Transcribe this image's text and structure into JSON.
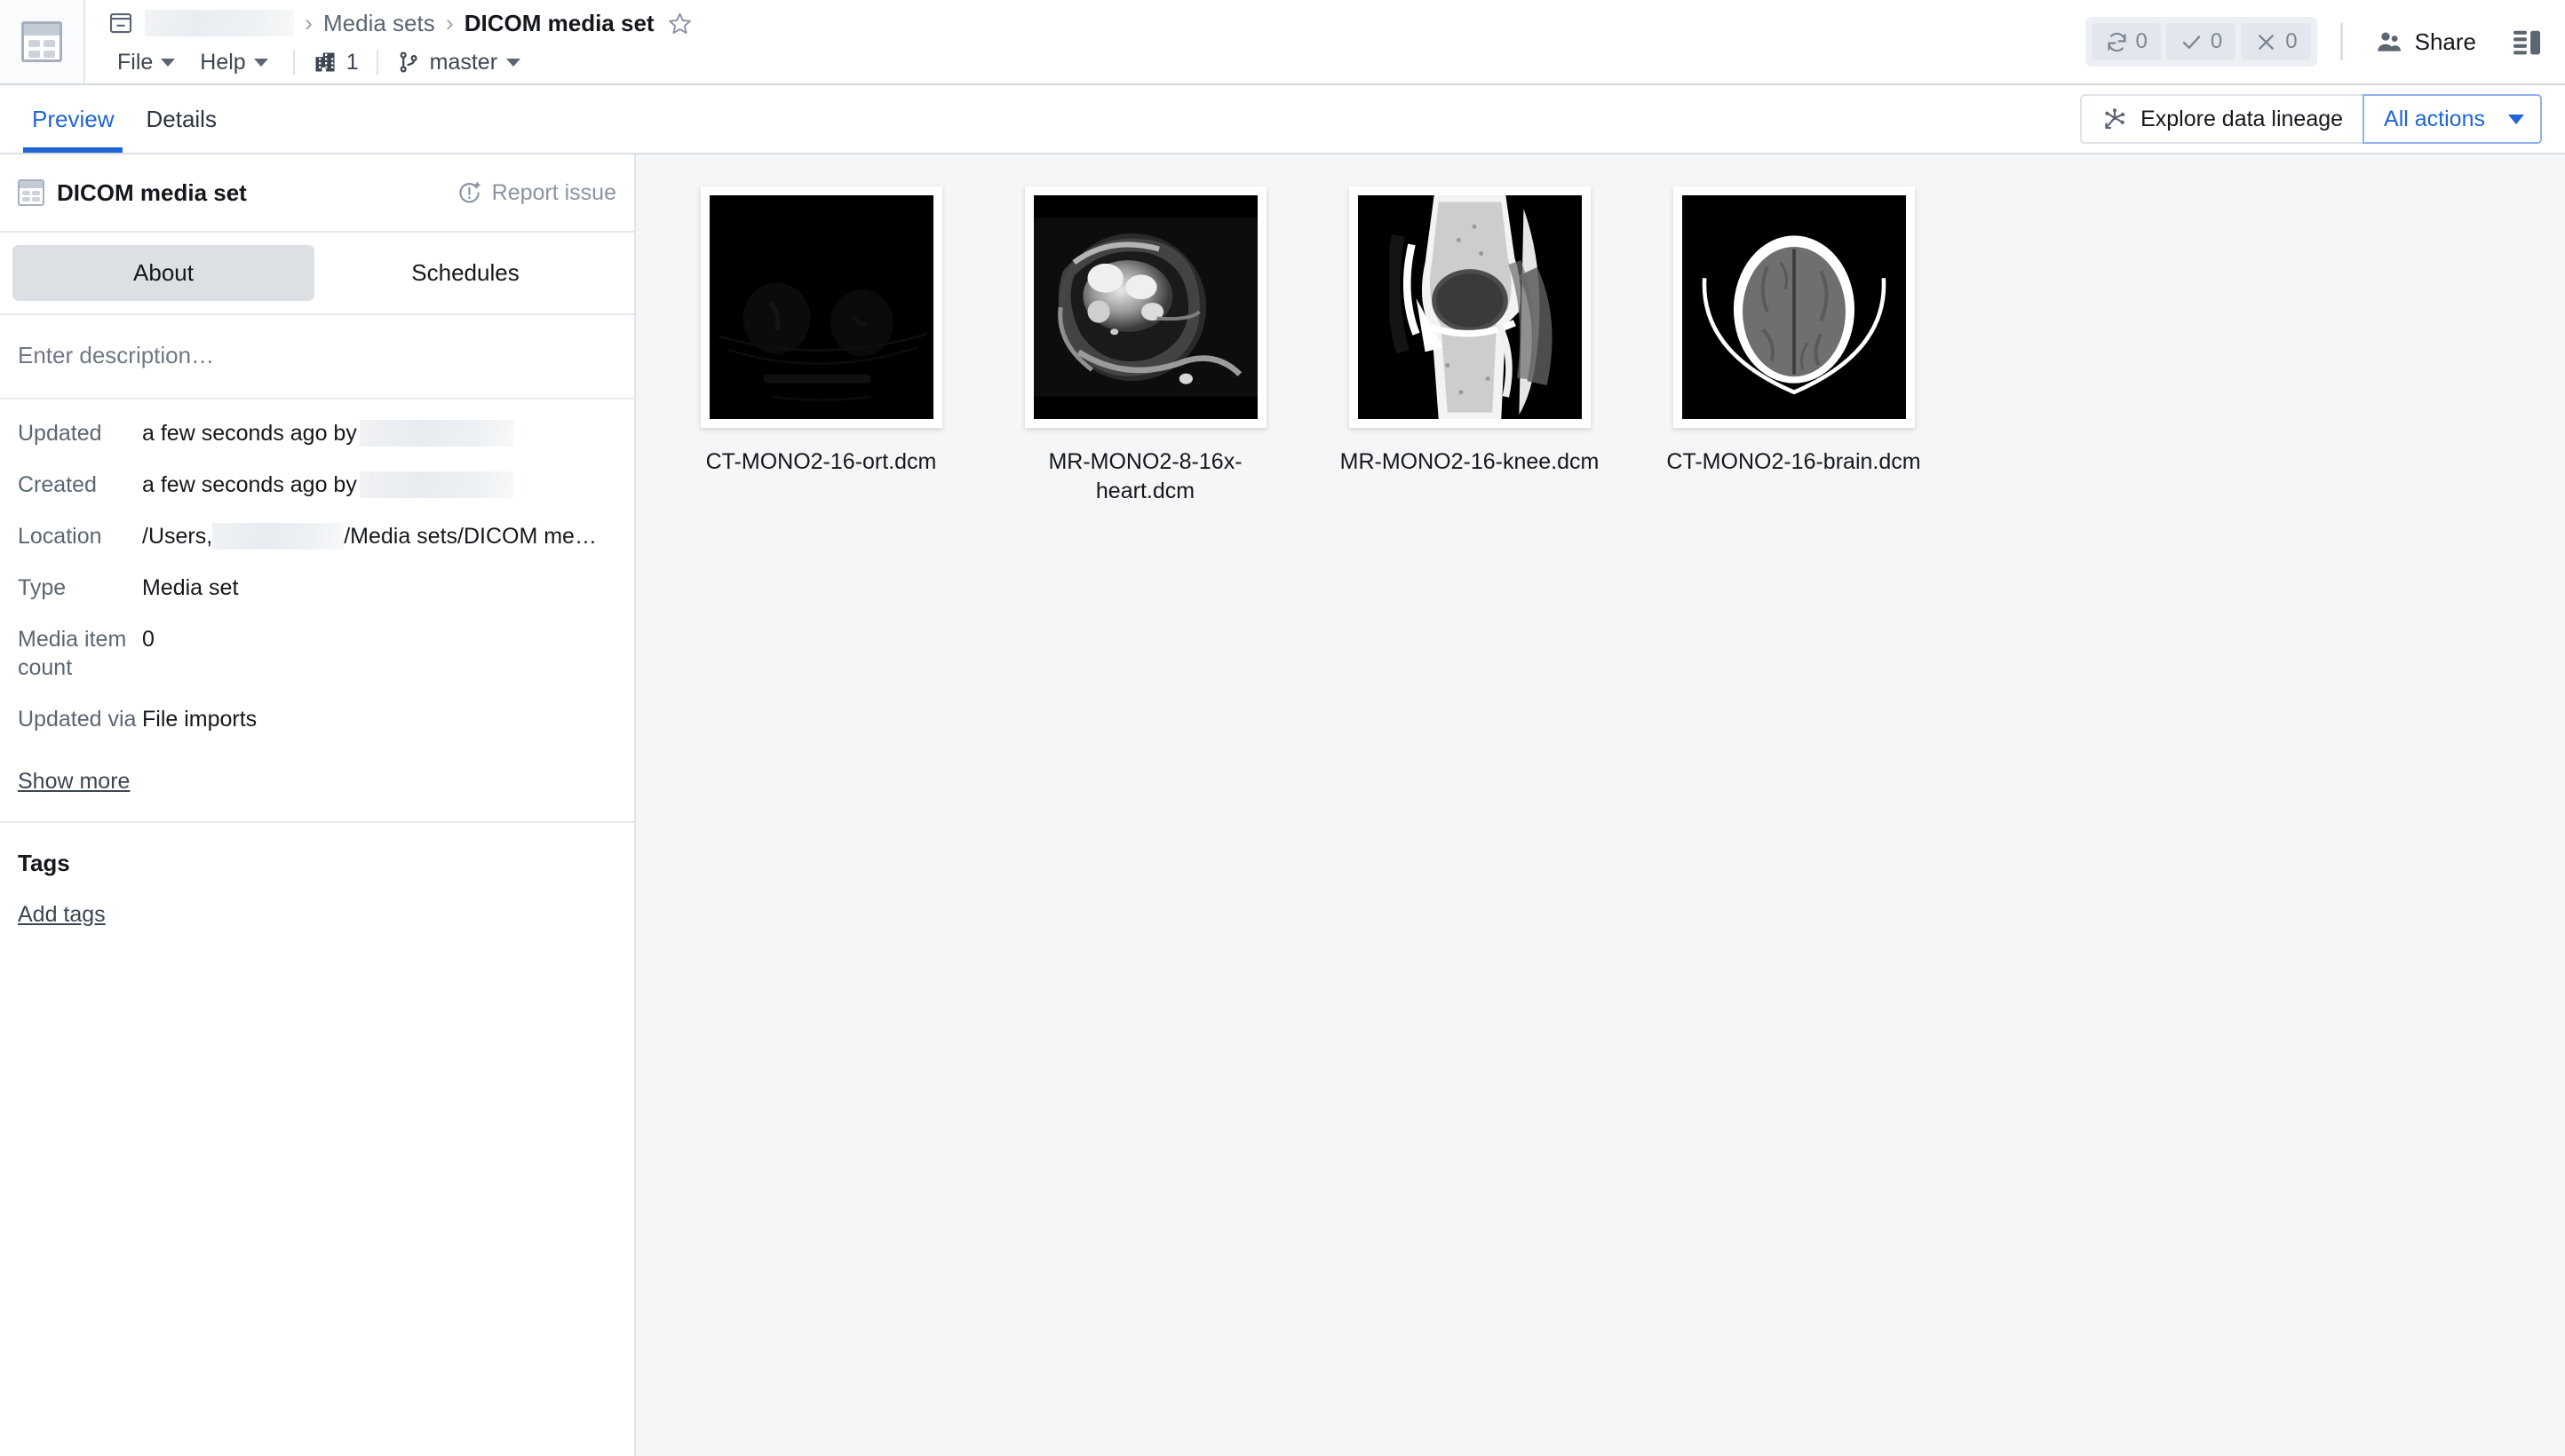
{
  "app": {
    "launcher_icon": "media-set-icon"
  },
  "header": {
    "breadcrumb": {
      "project_icon": "archive-box-icon",
      "project_name": "",
      "separator": "›",
      "items": [
        {
          "label": "Media sets",
          "current": false
        },
        {
          "label": "DICOM media set",
          "current": true
        }
      ],
      "favorite_icon": "star-outline-icon"
    },
    "menus": [
      {
        "label": "File",
        "icon": "chevron-down-icon"
      },
      {
        "label": "Help",
        "icon": "chevron-down-icon"
      }
    ],
    "org_chip": {
      "icon": "building-icon",
      "value": "1"
    },
    "branch_chip": {
      "icon": "git-branch-icon",
      "label": "master",
      "caret": "chevron-down-icon"
    },
    "status": [
      {
        "icon": "sync-icon",
        "value": "0"
      },
      {
        "icon": "check-icon",
        "value": "0"
      },
      {
        "icon": "close-icon",
        "value": "0"
      }
    ],
    "share": {
      "icon": "people-icon",
      "label": "Share"
    },
    "panel_toggle_icon": "right-panel-toggle-icon"
  },
  "subbar": {
    "tabs": [
      {
        "label": "Preview",
        "active": true
      },
      {
        "label": "Details",
        "active": false
      }
    ],
    "lineage_button": {
      "icon": "lineage-graph-icon",
      "label": "Explore data lineage"
    },
    "all_actions_button": {
      "label": "All actions",
      "caret": "chevron-down-icon"
    }
  },
  "sidebar": {
    "title": "DICOM media set",
    "title_icon": "media-set-icon",
    "report_issue": {
      "icon": "report-issue-icon",
      "label": "Report issue"
    },
    "segmented_tabs": [
      {
        "label": "About",
        "active": true
      },
      {
        "label": "Schedules",
        "active": false
      }
    ],
    "description_placeholder": "Enter description…",
    "metadata": [
      {
        "key": "Updated",
        "value": "a few seconds ago by",
        "redacted_suffix": true
      },
      {
        "key": "Created",
        "value": "a few seconds ago by",
        "redacted_suffix": true
      },
      {
        "key": "Location",
        "value_prefix": "/Users,",
        "value_suffix": "/Media sets/DICOM me…",
        "redacted_inline": true
      },
      {
        "key": "Type",
        "value": "Media set"
      },
      {
        "key": "Media item count",
        "value": "0"
      },
      {
        "key": "Updated via",
        "value": "File imports"
      }
    ],
    "show_more": "Show more",
    "tags_title": "Tags",
    "add_tags": "Add tags"
  },
  "content": {
    "items": [
      {
        "label": "CT-MONO2-16-ort.dcm",
        "thumb": "ct-ort"
      },
      {
        "label": "MR-MONO2-8-16x-heart.dcm",
        "thumb": "mr-heart"
      },
      {
        "label": "MR-MONO2-16-knee.dcm",
        "thumb": "mr-knee"
      },
      {
        "label": "CT-MONO2-16-brain.dcm",
        "thumb": "ct-brain"
      }
    ]
  },
  "colors": {
    "accent": "#1f65d6",
    "text": "#14181d",
    "muted": "#5c6673",
    "content_bg": "#f4f6f7",
    "border": "#e0e4e9"
  }
}
